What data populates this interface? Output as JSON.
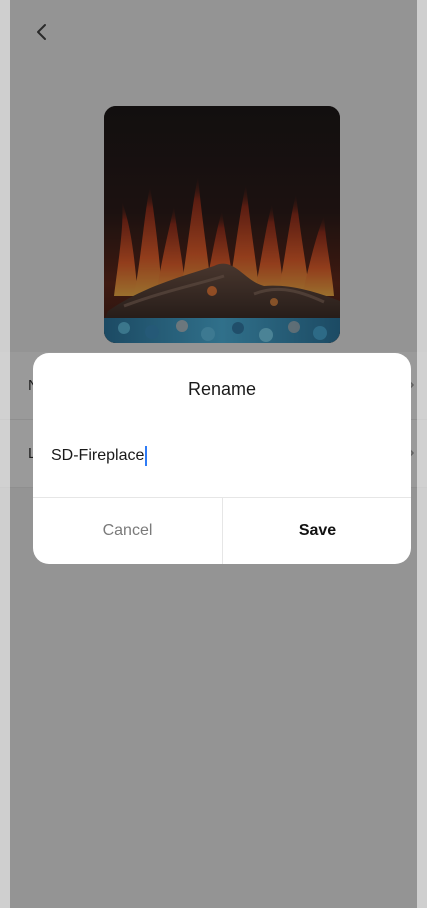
{
  "app": {
    "back_icon": "chevron-left-icon"
  },
  "device": {
    "image_subject": "fireplace-flames-image"
  },
  "list": {
    "rows": [
      {
        "label": "N"
      },
      {
        "label": "L"
      }
    ]
  },
  "dialog": {
    "title": "Rename",
    "input_value": "SD-Fireplace",
    "cancel_label": "Cancel",
    "save_label": "Save"
  },
  "colors": {
    "caret": "#2f7cf6",
    "overlay": "rgba(30,30,30,0.45)",
    "dialog_bg": "#ffffff"
  }
}
